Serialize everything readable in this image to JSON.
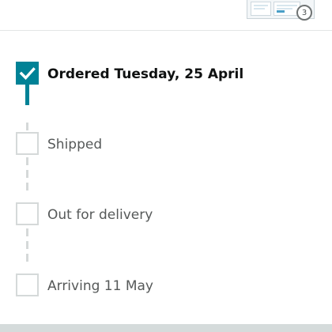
{
  "colors": {
    "accent": "#008296",
    "pending_border": "#d5d9d9",
    "text_primary": "#0f1111",
    "text_secondary": "#565959"
  },
  "header": {
    "thumbnail_icon": "package-thumbnail-icon",
    "badge_count": "3"
  },
  "steps": [
    {
      "label": "Ordered Tuesday, 25 April",
      "state": "done",
      "icon": "check-icon"
    },
    {
      "label": "Shipped",
      "state": "pending"
    },
    {
      "label": "Out for delivery",
      "state": "pending"
    },
    {
      "label": "Arriving 11 May",
      "state": "pending"
    }
  ]
}
